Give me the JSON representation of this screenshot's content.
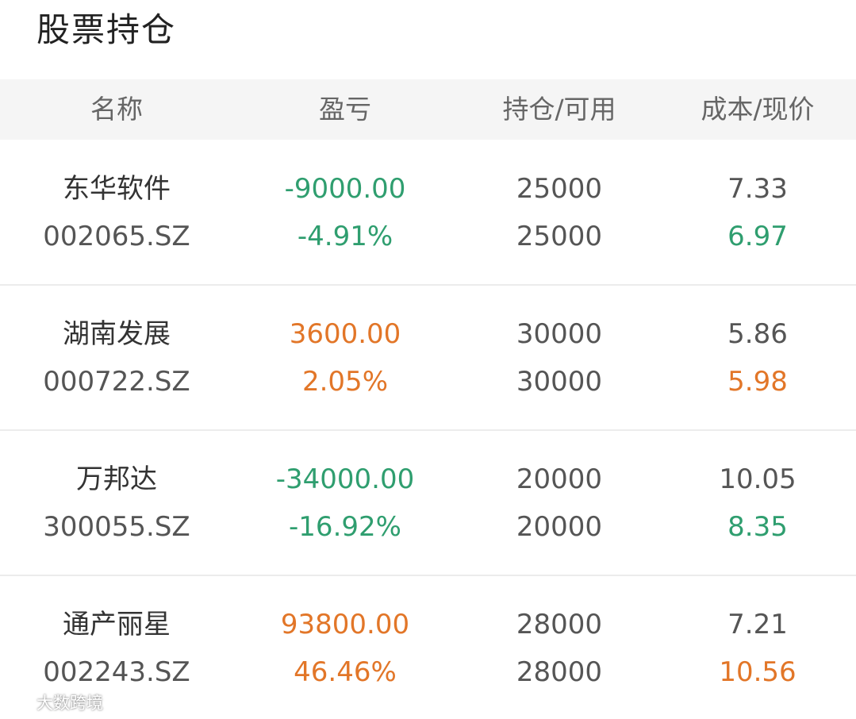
{
  "page": {
    "title": "股票持仓"
  },
  "table": {
    "headers": {
      "name": "名称",
      "pnl": "盈亏",
      "position": "持仓/可用",
      "price": "成本/现价"
    },
    "rows": [
      {
        "name": "东华软件",
        "code": "002065.SZ",
        "pnl": "-9000.00",
        "pnl_pct": "-4.91%",
        "holding": "25000",
        "available": "25000",
        "cost": "7.33",
        "current": "6.97",
        "trend": "down"
      },
      {
        "name": "湖南发展",
        "code": "000722.SZ",
        "pnl": "3600.00",
        "pnl_pct": "2.05%",
        "holding": "30000",
        "available": "30000",
        "cost": "5.86",
        "current": "5.98",
        "trend": "up"
      },
      {
        "name": "万邦达",
        "code": "300055.SZ",
        "pnl": "-34000.00",
        "pnl_pct": "-16.92%",
        "holding": "20000",
        "available": "20000",
        "cost": "10.05",
        "current": "8.35",
        "trend": "down"
      },
      {
        "name": "通产丽星",
        "code": "002243.SZ",
        "pnl": "93800.00",
        "pnl_pct": "46.46%",
        "holding": "28000",
        "available": "28000",
        "cost": "7.21",
        "current": "10.56",
        "trend": "up"
      }
    ]
  },
  "colors": {
    "loss": "#2f9e6f",
    "gain": "#e27628",
    "text_primary": "#333333",
    "text_secondary": "#555555",
    "header_bg": "#f5f5f5"
  },
  "watermark": {
    "text": "大数跨境",
    "icon": "brand-logo-icon"
  }
}
